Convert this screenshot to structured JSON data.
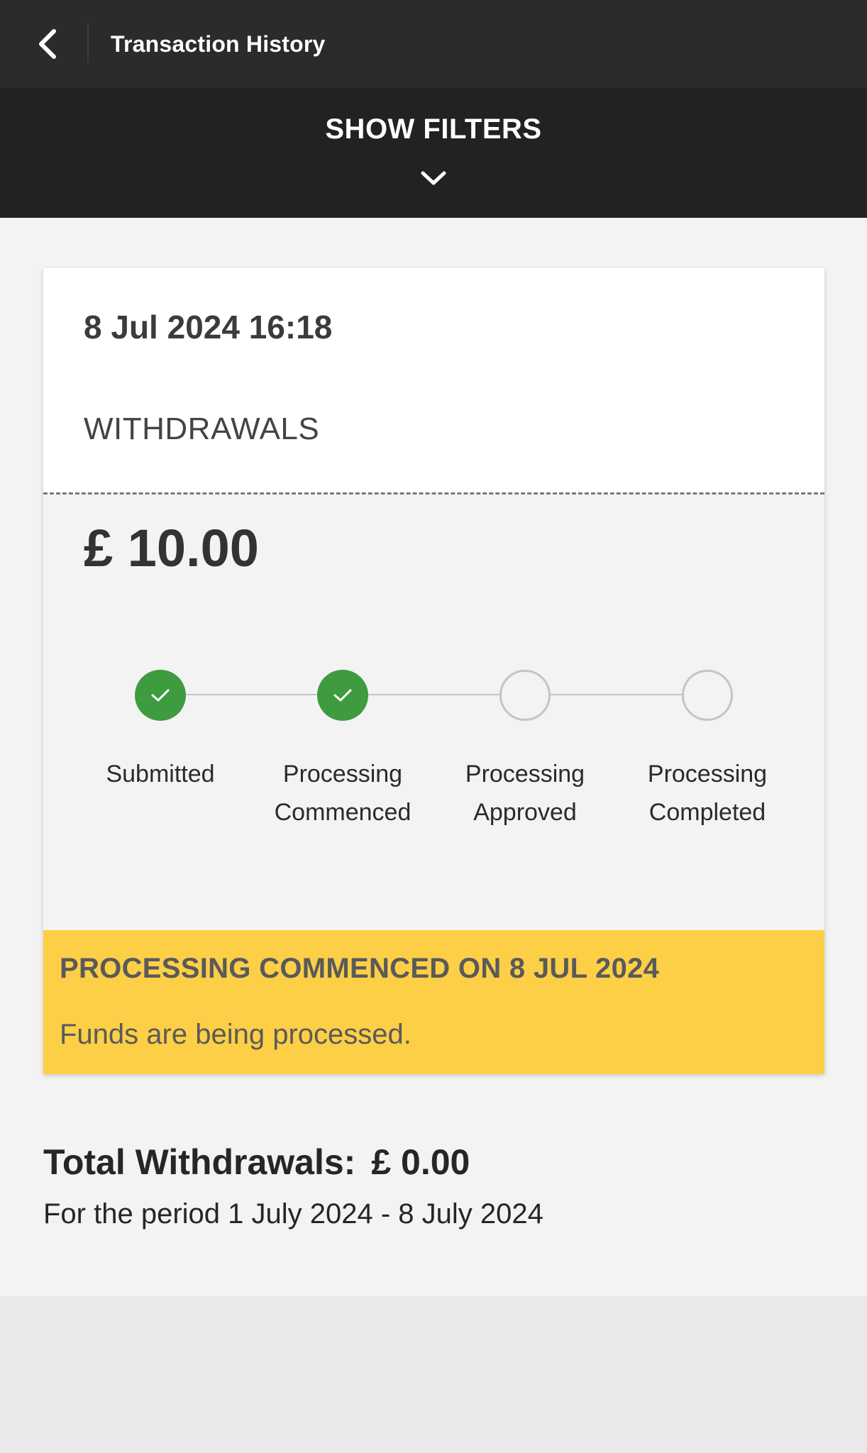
{
  "header": {
    "title": "Transaction History",
    "back_icon": "chevron-left-icon"
  },
  "filters": {
    "label": "SHOW FILTERS",
    "icon": "chevron-down-icon"
  },
  "transaction": {
    "datetime": "8 Jul 2024 16:18",
    "type": "WITHDRAWALS",
    "amount": "£ 10.00",
    "steps": [
      {
        "line1": "Submitted",
        "line2": "",
        "done": true
      },
      {
        "line1": "Processing",
        "line2": "Commenced",
        "done": true
      },
      {
        "line1": "Processing",
        "line2": "Approved",
        "done": false
      },
      {
        "line1": "Processing",
        "line2": "Completed",
        "done": false
      }
    ],
    "status": {
      "title": "PROCESSING COMMENCED ON 8 JUL 2024",
      "message": "Funds are being processed."
    }
  },
  "summary": {
    "label": "Total Withdrawals:",
    "amount": "£ 0.00",
    "period": "For the period 1 July 2024 - 8 July 2024"
  },
  "colors": {
    "topbar": "#2b2b2b",
    "filters_bar": "#222222",
    "step_done": "#3e9b40",
    "status_box": "#fdcf46"
  }
}
